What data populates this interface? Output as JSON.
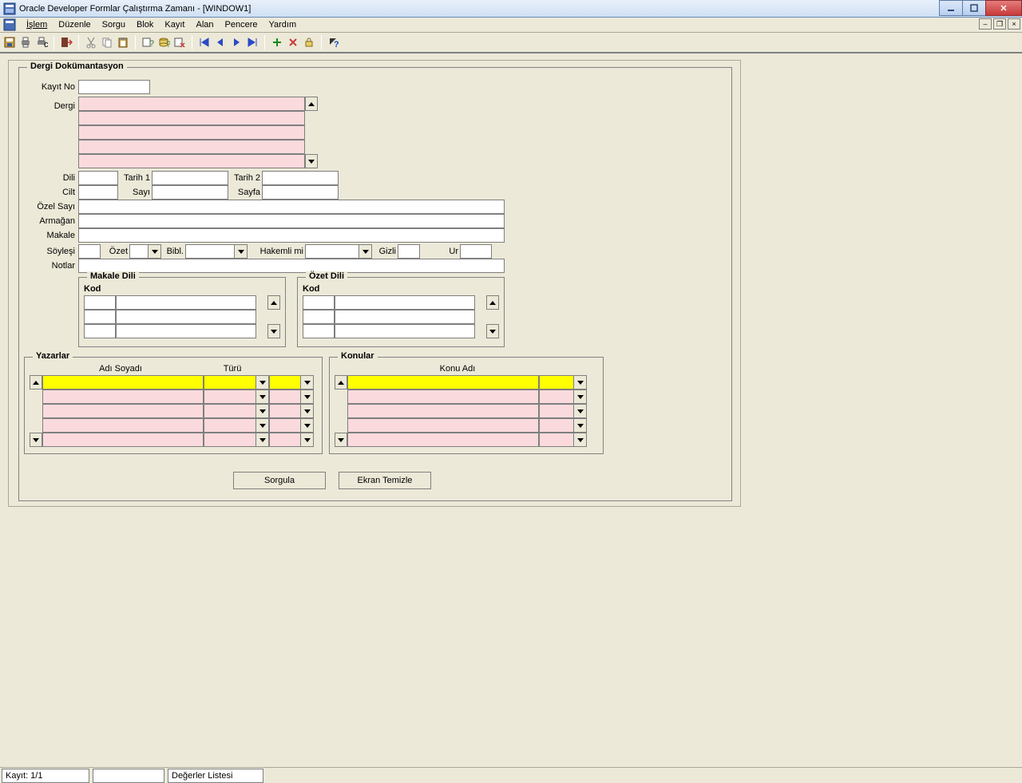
{
  "window": {
    "title": "Oracle Developer Formlar Çalıştırma Zamanı - [WINDOW1]"
  },
  "menu": {
    "islem": "İşlem",
    "duzenle": "Düzenle",
    "sorgu": "Sorgu",
    "blok": "Blok",
    "kayit": "Kayıt",
    "alan": "Alan",
    "pencere": "Pencere",
    "yardim": "Yardım"
  },
  "fs": {
    "dergi_dok": "Dergi Dokümantasyon",
    "makale_dili": "Makale Dili",
    "ozet_dili": "Özet Dili",
    "yazarlar": "Yazarlar",
    "konular": "Konular"
  },
  "labels": {
    "kayit_no": "Kayıt No",
    "dergi": "Dergi",
    "dili": "Dili",
    "tarih1": "Tarih 1",
    "tarih2": "Tarih 2",
    "cilt": "Cilt",
    "sayi": "Sayı",
    "sayfa": "Sayfa",
    "ozel_sayi": "Özel Sayı",
    "armagan": "Armağan",
    "makale": "Makale",
    "soylesi": "Söyleşi",
    "notlar": "Notlar",
    "ozet": "Özet",
    "bibl": "Bibl.",
    "hakemli": "Hakemli mi",
    "gizli": "Gizli",
    "ur": "Ur",
    "kod": "Kod",
    "adi_soyadi": "Adı Soyadı",
    "turu": "Türü",
    "konu_adi": "Konu Adı"
  },
  "buttons": {
    "sorgula": "Sorgula",
    "ekran_temizle": "Ekran Temizle"
  },
  "status": {
    "kayit": "Kayıt: 1/1",
    "degerler": "Değerler Listesi"
  },
  "values": {
    "kayit_no": "",
    "dili": "",
    "tarih1": "",
    "tarih2": "",
    "cilt": "",
    "sayi": "",
    "sayfa": "",
    "ozel_sayi": "",
    "armagan": "",
    "makale": "",
    "soylesi": "",
    "notlar": "",
    "ozet": "",
    "bibl": "",
    "hakemli": "",
    "gizli": "",
    "ur": "",
    "dergi_rows": [
      "",
      "",
      "",
      "",
      ""
    ],
    "makale_dili_rows": [
      {
        "kod": "",
        "aciklama": ""
      },
      {
        "kod": "",
        "aciklama": ""
      },
      {
        "kod": "",
        "aciklama": ""
      }
    ],
    "ozet_dili_rows": [
      {
        "kod": "",
        "aciklama": ""
      },
      {
        "kod": "",
        "aciklama": ""
      },
      {
        "kod": "",
        "aciklama": ""
      }
    ],
    "yazarlar_rows": [
      {
        "adi": "",
        "turu": "",
        "x": ""
      },
      {
        "adi": "",
        "turu": "",
        "x": ""
      },
      {
        "adi": "",
        "turu": "",
        "x": ""
      },
      {
        "adi": "",
        "turu": "",
        "x": ""
      },
      {
        "adi": "",
        "turu": "",
        "x": ""
      }
    ],
    "konular_rows": [
      {
        "konu": "",
        "x": ""
      },
      {
        "konu": "",
        "x": ""
      },
      {
        "konu": "",
        "x": ""
      },
      {
        "konu": "",
        "x": ""
      },
      {
        "konu": "",
        "x": ""
      }
    ]
  }
}
